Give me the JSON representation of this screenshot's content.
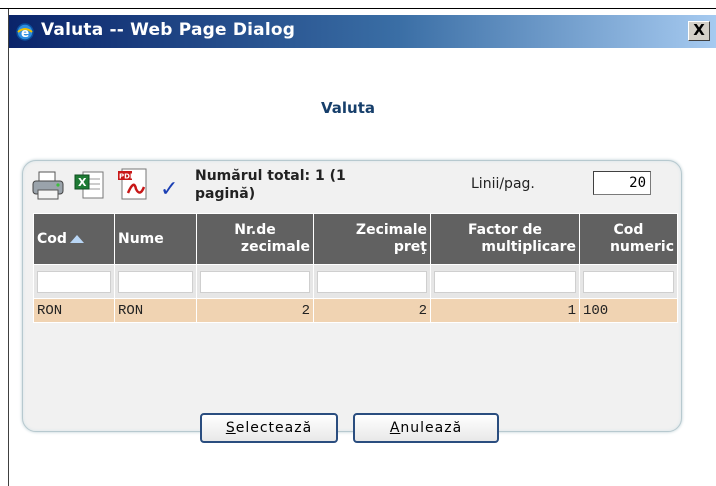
{
  "window": {
    "title": "Valuta -- Web Page Dialog",
    "close_glyph": "X"
  },
  "dialog": {
    "heading": "Valuta"
  },
  "toolbar": {
    "icons": [
      "print-icon",
      "excel-icon",
      "pdf-icon",
      "check-icon"
    ],
    "total_text_line1": "Numărul total: 1 (1",
    "total_text_line2": "pagină)",
    "rows_per_page_label": "Linii/pag.",
    "rows_per_page_value": "20"
  },
  "table": {
    "columns": [
      {
        "line1": "Cod",
        "line2": ""
      },
      {
        "line1": "Nume",
        "line2": ""
      },
      {
        "line1": "Nr.de",
        "line2": "zecimale"
      },
      {
        "line1": "Zecimale",
        "line2": "preţ"
      },
      {
        "line1": "Factor de",
        "line2": "multiplicare"
      },
      {
        "line1": "Cod",
        "line2": "numeric"
      }
    ],
    "rows": [
      [
        "RON",
        "RON",
        "2",
        "2",
        "1",
        "100"
      ]
    ]
  },
  "buttons": {
    "select_first": "S",
    "select_rest": "electează",
    "cancel_first": "A",
    "cancel_rest": "nulează"
  },
  "colors": {
    "header_bg": "#616161",
    "row_bg": "#f0d3b2",
    "title_gradient_start": "#0a246a",
    "title_gradient_end": "#a6caf0"
  }
}
